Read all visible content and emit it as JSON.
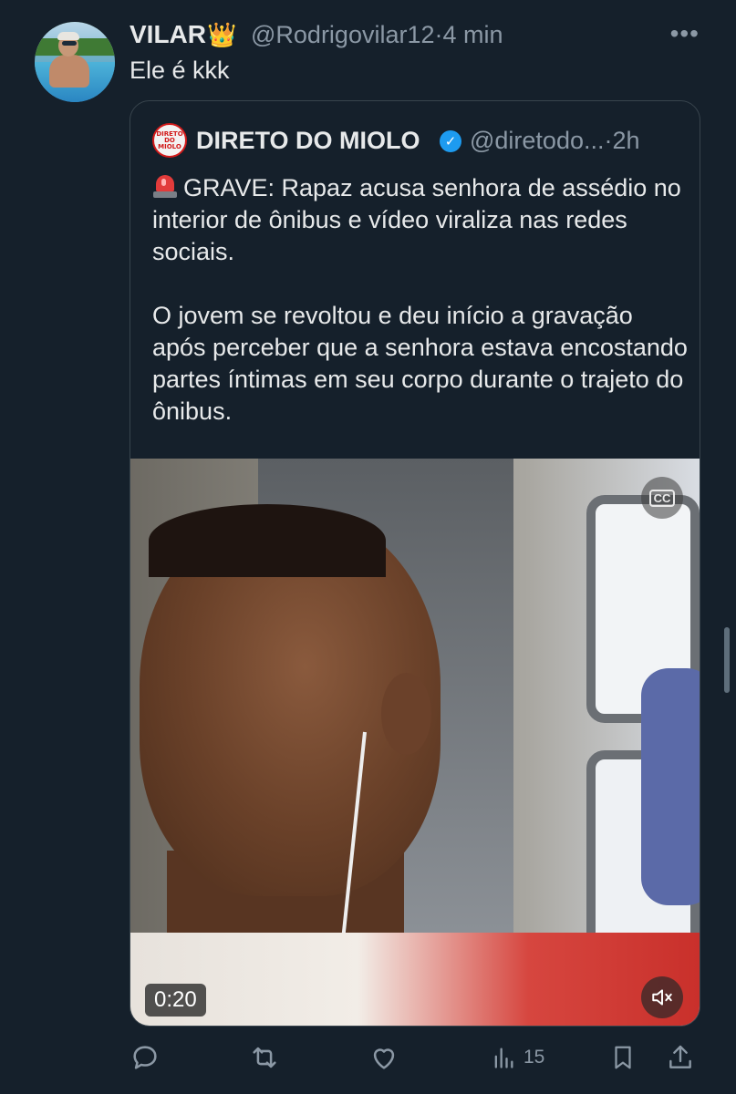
{
  "tweet": {
    "author_name": "VILAR",
    "author_emoji": "👑",
    "handle": "@Rodrigovilar12",
    "separator": "·",
    "time": "4 min",
    "more_label": "•••",
    "text": "Ele é kkk"
  },
  "quoted": {
    "avatar_text": "DIRETO DO MIOLO",
    "name": "DIRETO DO MIOLO",
    "verified_mark": "✓",
    "handle": "@diretodo...",
    "separator": "·",
    "time": "2h",
    "paragraph1": "GRAVE: Rapaz acusa senhora de assédio no interior de ônibus e vídeo viraliza nas redes sociais.",
    "paragraph2": "O jovem se revoltou e deu início a gravação após perceber que a senhora estava encostando partes íntimas em seu corpo durante o trajeto do ônibus.",
    "video": {
      "duration": "0:20",
      "captions_label": "CC",
      "muted": true
    }
  },
  "actions": {
    "views_count": "15"
  },
  "colors": {
    "background": "#15202b",
    "text": "#e7e9ea",
    "secondary": "#8b98a5",
    "border": "#38444d",
    "verified": "#1d9bf0"
  },
  "icons": [
    "more-icon",
    "verified-icon",
    "siren-icon",
    "captions-off-icon",
    "mute-icon",
    "reply-icon",
    "retweet-icon",
    "like-icon",
    "views-icon",
    "bookmark-icon",
    "share-icon"
  ]
}
